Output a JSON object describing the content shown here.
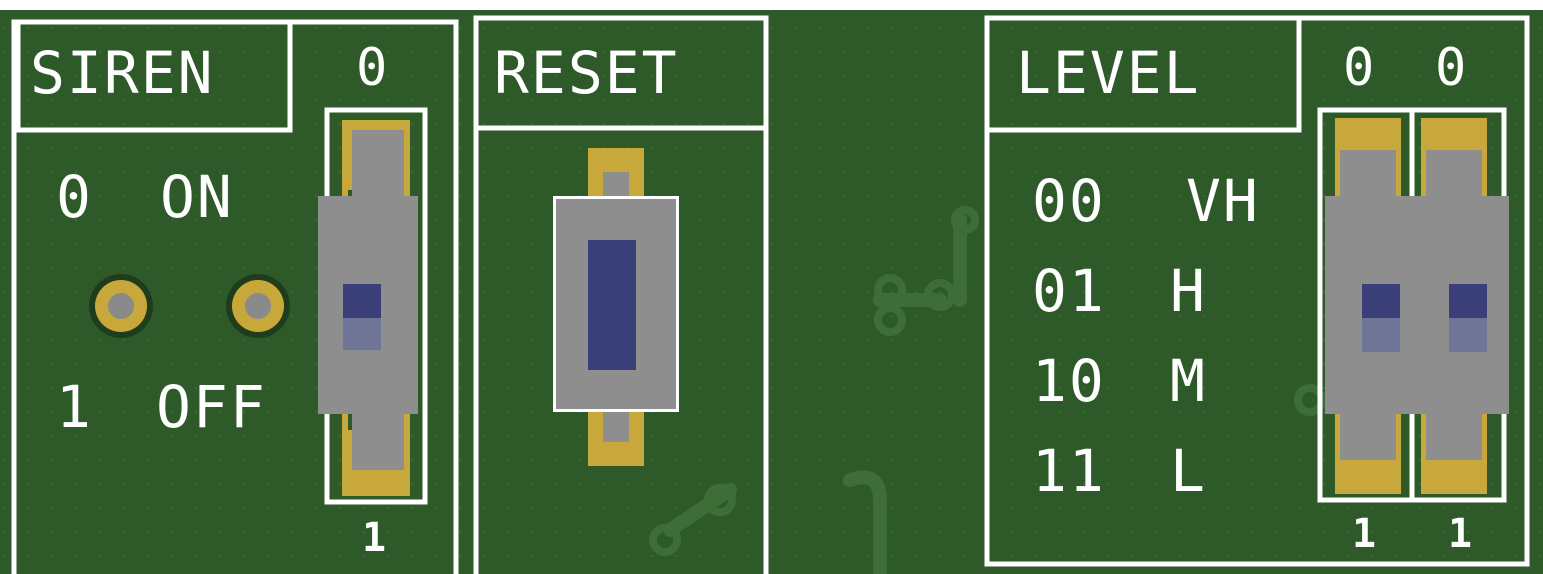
{
  "colors": {
    "board": "#2e5a2a",
    "silkscreen": "#ffffff",
    "copper_pad": "#c8a83a",
    "switch_body": "#8e8e8e",
    "switch_knob": "#3a3f7a"
  },
  "siren": {
    "title": "SIREN",
    "top_label": "0",
    "bottom_label": "1",
    "row_on": {
      "value": "0",
      "label": "ON"
    },
    "row_off": {
      "value": "1",
      "label": "OFF"
    }
  },
  "reset": {
    "title": "RESET"
  },
  "level": {
    "title": "LEVEL",
    "top_labels": [
      "0",
      "0"
    ],
    "bottom_labels": [
      "1",
      "1"
    ],
    "table": [
      {
        "code": "00",
        "level": "VH"
      },
      {
        "code": "01",
        "level": "H"
      },
      {
        "code": "10",
        "level": "M"
      },
      {
        "code": "11",
        "level": "L"
      }
    ]
  }
}
